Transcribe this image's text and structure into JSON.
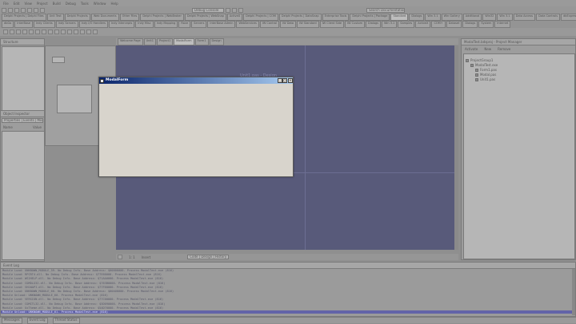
{
  "menu": [
    "File",
    "Edit",
    "View",
    "Project",
    "Build",
    "Debug",
    "Tools",
    "Window",
    "Help"
  ],
  "toolbar": {
    "config": "Debug Console",
    "search": "Search Documentation"
  },
  "tabs_row1": [
    "Delphi Projects | Delphi Files",
    "Unit Test",
    "Delphi Projects",
    "Web Documents",
    "Other Files",
    "Delphi Projects | WebBroker",
    "Delphi Projects | WebSnap",
    "ActiveX",
    "Delphi Projects | COM",
    "Delphi Projects | DataSnap",
    "Enterprise Tools",
    "Delphi Projects | Package",
    "Standard",
    "Dialogs",
    "Win 3.1",
    "Win Gallery",
    "Additional",
    "Win32",
    "Win 3.1",
    "Data Access",
    "Data Controls",
    "dbExpress",
    "DataSnap",
    "BDE"
  ],
  "tabs_row2": [
    "dbGo",
    "InterBase",
    "Indy Clients",
    "Indy Servers",
    "Indy I/O Handlers",
    "Indy Intercepts",
    "Indy Misc",
    "Indy Mapping",
    "Rave",
    "Servers",
    "InterBase Admin",
    "WebServices",
    "IW Control",
    "IW Data",
    "IW Standard",
    "IW Client Side",
    "IW Custom",
    "Dialogs",
    "Win 3.1",
    "Samples",
    "ActiveX",
    "COM+",
    "Dataset",
    "Dialogs",
    "System",
    "Internet"
  ],
  "left_panel": {
    "structure_title": "Structure",
    "object_inspector_title": "Object Inspector",
    "inspector_combo": "Properties | Events | Modal",
    "col_name": "Name",
    "col_value": "Value"
  },
  "document_tabs": [
    "Welcome Page",
    "Unit1",
    "Project1",
    "ModalForm",
    "Form1",
    "Design"
  ],
  "designer_caption": "Unit1.pas - Design",
  "right_panel": {
    "title": "ModalTest.bdsproj - Project Manager",
    "activate": "Activate",
    "new": "New",
    "remove": "Remove",
    "tree": [
      "ProjectGroup1",
      "ModalTest.exe",
      "Form1.pas",
      "Modal.pas",
      "Unit1.pas"
    ]
  },
  "modal": {
    "title": "ModalForm",
    "minimize": "_",
    "maximize": "□",
    "close": "×"
  },
  "editor_status": {
    "position": "1: 1",
    "mode": "Insert",
    "tabs": "Code | Design | History"
  },
  "output": {
    "title": "Event Log",
    "lines": [
      "Module Load: UNKNOWN_MODULE_59. No Debug Info. Base Address: $00800000. Process ModalTest.exe (816)",
      "Module Load: RPCRT4.dll. No Debug Info. Base Address: $77E60000. Process ModalTest.exe (816)",
      "Module Load: WS2HELP.dll. No Debug Info. Base Address: $71AA0000. Process ModalTest.exe (816)",
      "Module Load: COMDLG32.dll. No Debug Info. Base Address: $763B0000. Process ModalTest.exe (816)",
      "Module Load: SHLWAPI.dll. No Debug Info. Base Address: $77F60000. Process ModalTest.exe (816)",
      "Module Load: UNKNOWN_MODULE_60. No Debug Info. Base Address: $00A00000. Process ModalTest.exe (816)",
      "Module Unload: UNKNOWN_MODULE_60. Process ModalTest.exe (816)",
      "Module Load: VERSION.dll. No Debug Info. Base Address: $77C00000. Process ModalTest.exe (816)",
      "Module Load: COMCTL32.dll. No Debug Info. Base Address: $5D090000. Process ModalTest.exe (816)",
      "Module Load: UxTheme.dll. No Debug Info. Base Address: $5AD70000. Process ModalTest.exe (816)",
      "Module Unload: UNKNOWN_MODULE_61. Process ModalTest.exe (816)"
    ]
  },
  "status_tabs": [
    "Messages",
    "Event Log",
    "Thread Status"
  ]
}
